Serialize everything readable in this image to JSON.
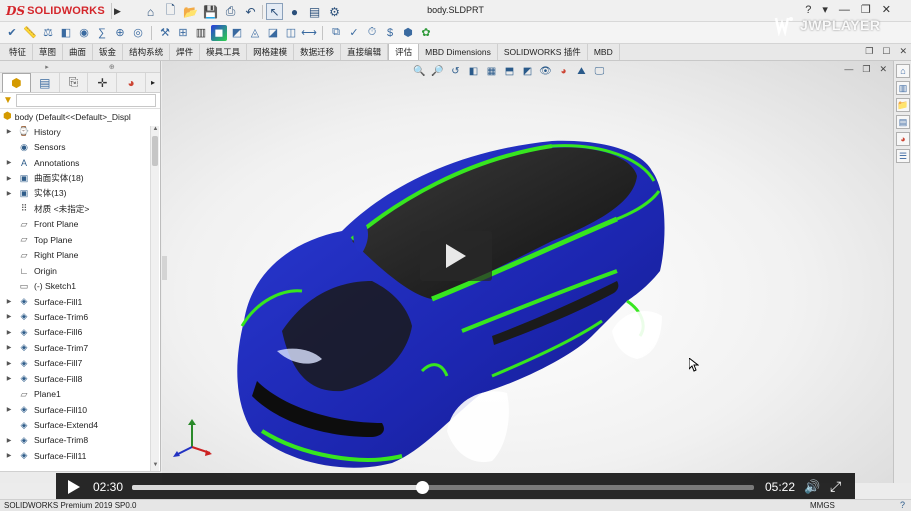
{
  "app": {
    "logo_ds": "DS",
    "logo_brand": "SOLIDWORKS",
    "doc_title": "body.SLDPRT",
    "win_controls": [
      "?",
      "▾",
      "—",
      "❐",
      "✕"
    ]
  },
  "tabs": [
    {
      "label": "特征",
      "active": false
    },
    {
      "label": "草图",
      "active": false
    },
    {
      "label": "曲面",
      "active": false
    },
    {
      "label": "钣金",
      "active": false
    },
    {
      "label": "结构系统",
      "active": false
    },
    {
      "label": "焊件",
      "active": false
    },
    {
      "label": "模具工具",
      "active": false
    },
    {
      "label": "网格建模",
      "active": false
    },
    {
      "label": "数据迁移",
      "active": false
    },
    {
      "label": "直接编辑",
      "active": false
    },
    {
      "label": "评估",
      "active": true
    },
    {
      "label": "MBD Dimensions",
      "active": false
    },
    {
      "label": "SOLIDWORKS 插件",
      "active": false
    },
    {
      "label": "MBD",
      "active": false
    }
  ],
  "feature_tree": {
    "root": "body  (Default<<Default>_Displ",
    "items": [
      {
        "label": "History",
        "expandable": true,
        "icon": "history-icon"
      },
      {
        "label": "Sensors",
        "expandable": true,
        "icon": "sensor-icon"
      },
      {
        "label": "Annotations",
        "expandable": true,
        "icon": "annotation-icon"
      },
      {
        "label": "曲面实体(18)",
        "expandable": true,
        "icon": "surface-bodies-icon"
      },
      {
        "label": "实体(13)",
        "expandable": true,
        "icon": "solid-bodies-icon"
      },
      {
        "label": "材质 <未指定>",
        "expandable": false,
        "icon": "material-icon"
      },
      {
        "label": "Front Plane",
        "expandable": false,
        "icon": "plane-icon"
      },
      {
        "label": "Top Plane",
        "expandable": false,
        "icon": "plane-icon"
      },
      {
        "label": "Right Plane",
        "expandable": false,
        "icon": "plane-icon"
      },
      {
        "label": "Origin",
        "expandable": false,
        "icon": "origin-icon"
      },
      {
        "label": "(-) Sketch1",
        "expandable": false,
        "icon": "sketch-icon"
      },
      {
        "label": "Surface-Fill1",
        "expandable": true,
        "icon": "surface-fill-icon"
      },
      {
        "label": "Surface-Trim6",
        "expandable": true,
        "icon": "surface-trim-icon"
      },
      {
        "label": "Surface-Fill6",
        "expandable": true,
        "icon": "surface-fill-icon"
      },
      {
        "label": "Surface-Trim7",
        "expandable": true,
        "icon": "surface-trim-icon"
      },
      {
        "label": "Surface-Fill7",
        "expandable": true,
        "icon": "surface-fill-icon"
      },
      {
        "label": "Surface-Fill8",
        "expandable": true,
        "icon": "surface-fill-icon"
      },
      {
        "label": "Plane1",
        "expandable": false,
        "icon": "plane-icon"
      },
      {
        "label": "Surface-Fill10",
        "expandable": true,
        "icon": "surface-fill-icon"
      },
      {
        "label": "Surface-Extend4",
        "expandable": false,
        "icon": "surface-extend-icon"
      },
      {
        "label": "Surface-Trim8",
        "expandable": true,
        "icon": "surface-trim-icon"
      },
      {
        "label": "Surface-Fill11",
        "expandable": true,
        "icon": "surface-fill-icon"
      }
    ]
  },
  "player": {
    "watermark": "JWPLAYER",
    "current_time": "02:30",
    "duration": "05:22",
    "progress_fraction": 0.466
  },
  "status": {
    "product": "SOLIDWORKS Premium 2019 SP0.0",
    "units": "MMGS",
    "help": "?"
  },
  "colors": {
    "brand_red": "#d4262b",
    "car_blue": "#1f2fbf",
    "car_green": "#37e61f",
    "car_dark": "#1c1c1c"
  }
}
